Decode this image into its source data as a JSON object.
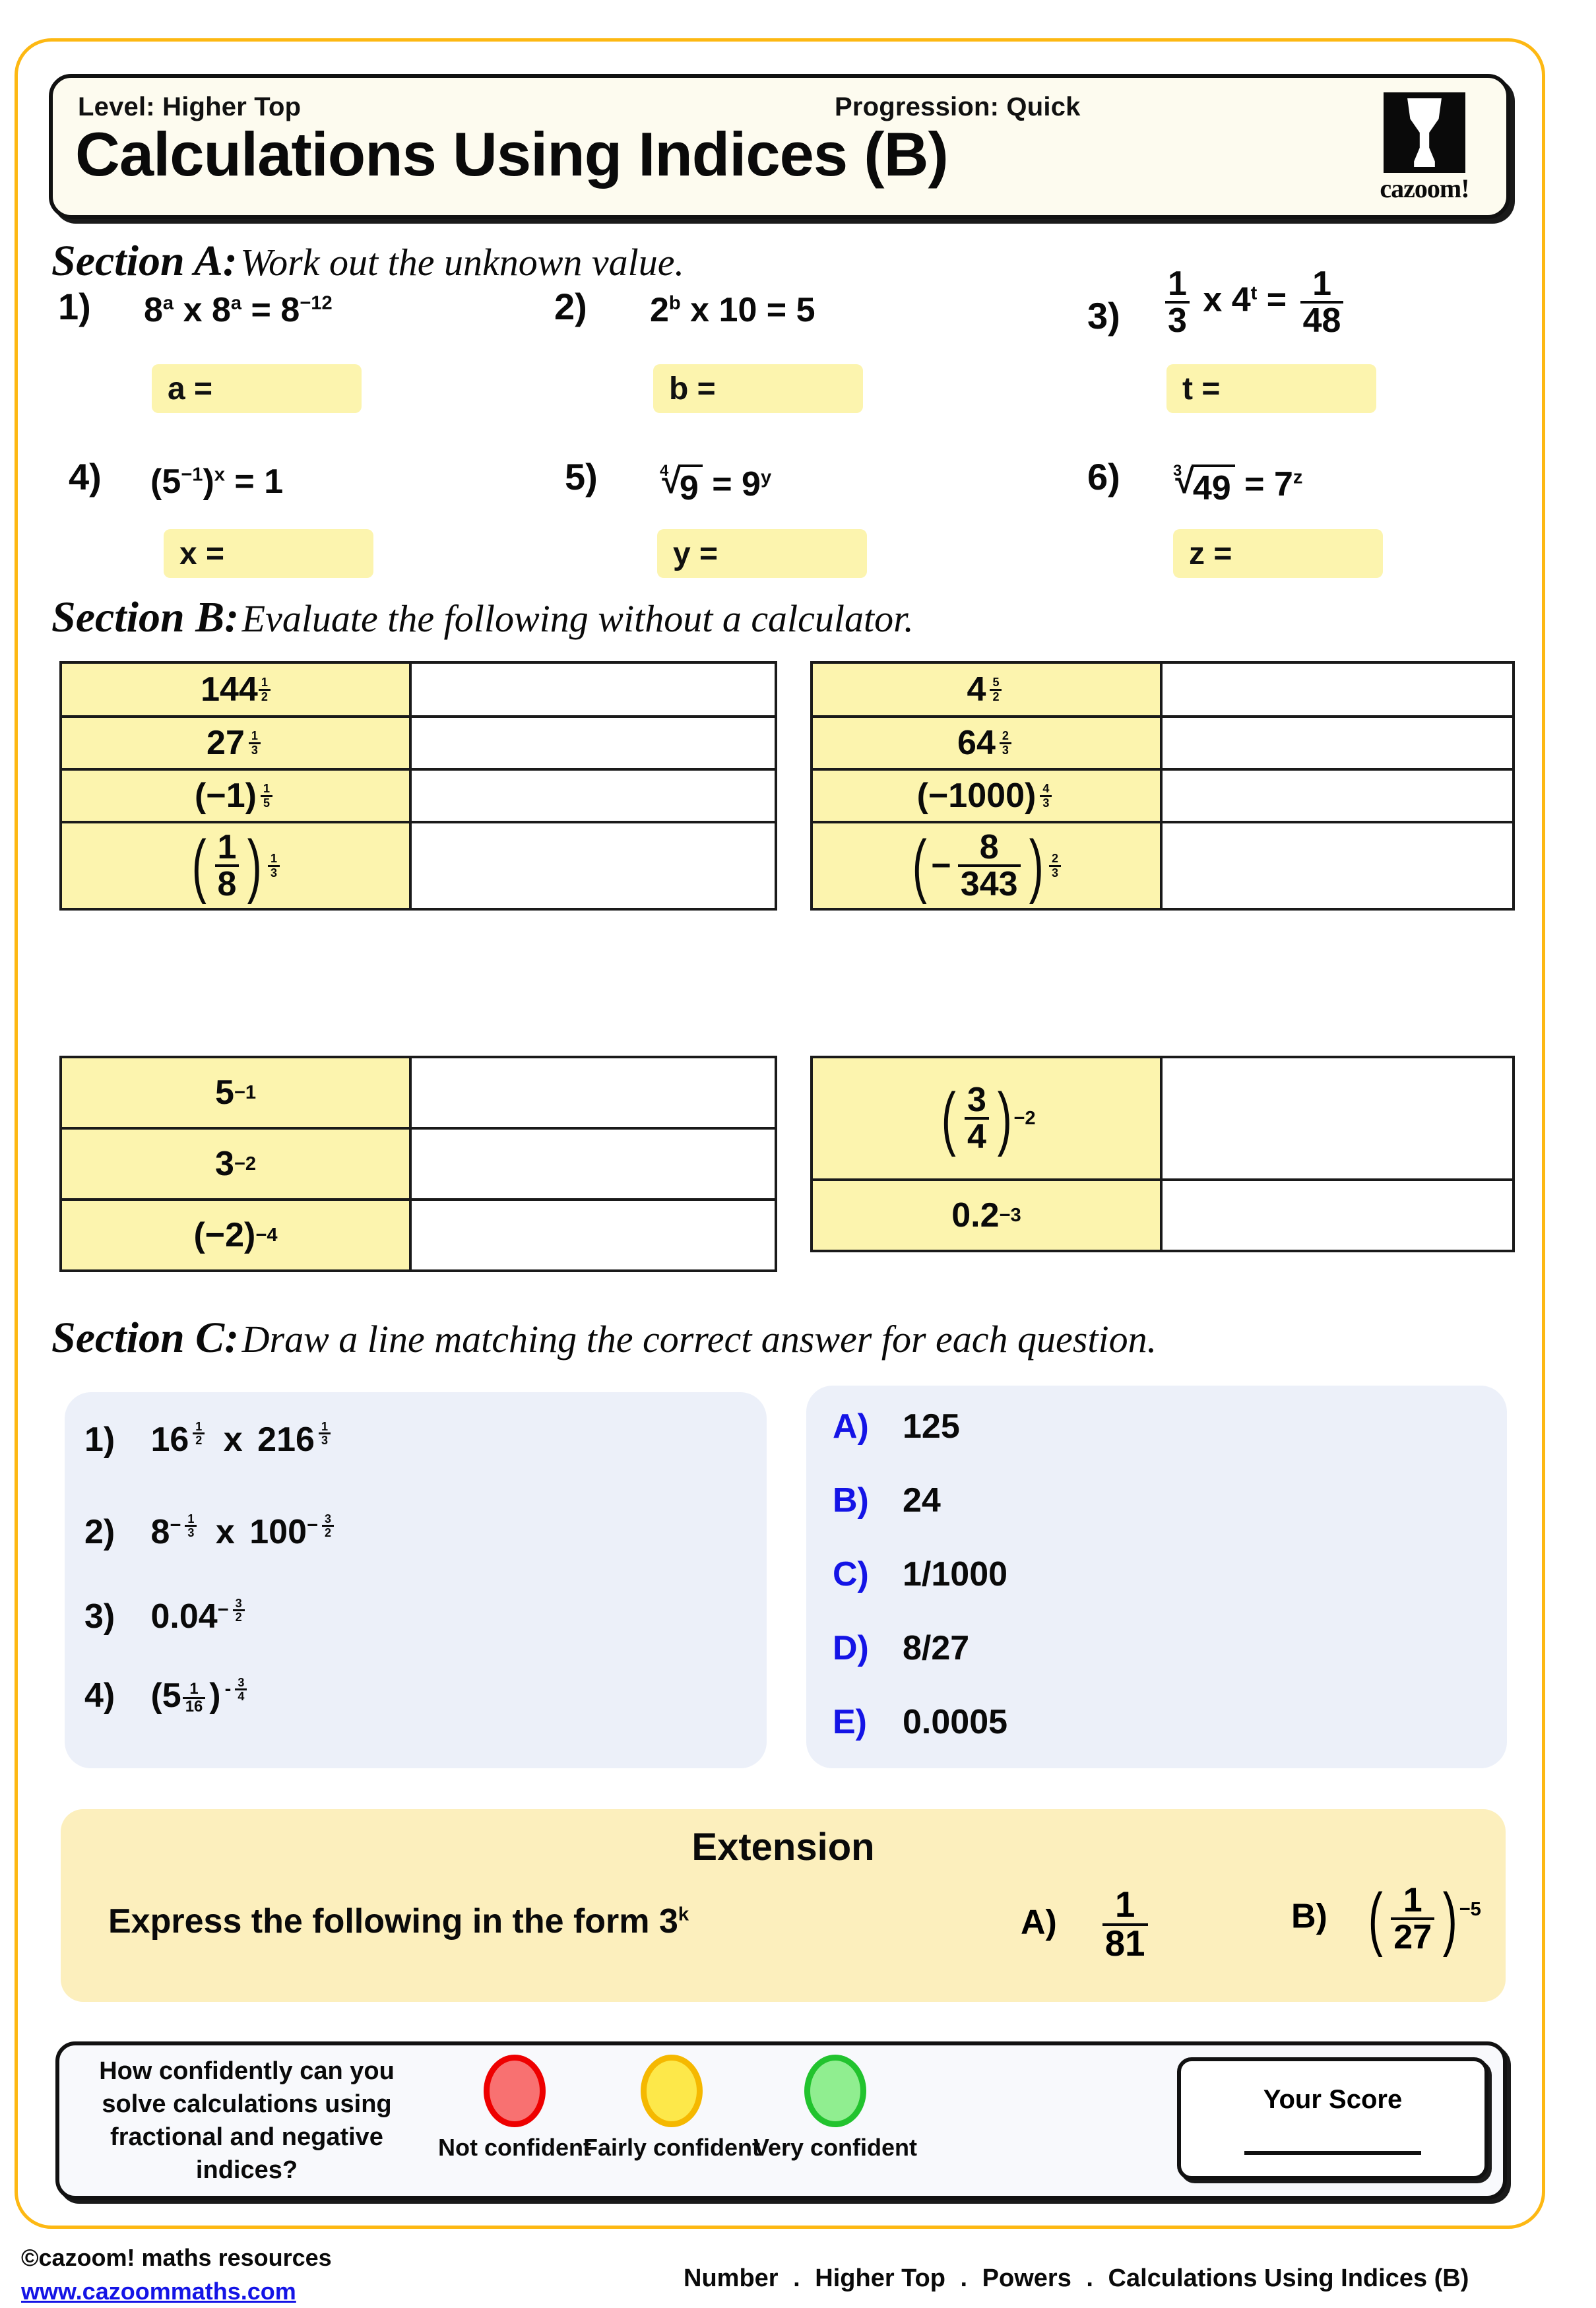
{
  "page": {
    "border_color": "#FDB813",
    "background": "#ffffff"
  },
  "header": {
    "level": "Level: Higher Top",
    "progression": "Progression: Quick",
    "title": "Calculations Using Indices (B)",
    "logo_word": "cazoom!",
    "logo_icon": "cazoom-goblet-logo"
  },
  "sectionA": {
    "label": "Section A:",
    "instruction": "Work out the unknown value.",
    "questions": [
      {
        "num": "1)",
        "expr": "8ᵃ x 8ᵃ = 8⁻¹²",
        "answer_label": "a =",
        "answer_value": ""
      },
      {
        "num": "2)",
        "expr": "2ᵇ x 10 = 5",
        "answer_label": "b =",
        "answer_value": ""
      },
      {
        "num": "3)",
        "expr": "1/3 x 4ᵗ = 1/48",
        "answer_label": "t =",
        "answer_value": ""
      },
      {
        "num": "4)",
        "expr": "(5⁻¹)ˣ = 1",
        "answer_label": "x =",
        "answer_value": ""
      },
      {
        "num": "5)",
        "expr": "⁴√9 = 9ʸ",
        "answer_label": "y =",
        "answer_value": ""
      },
      {
        "num": "6)",
        "expr": "³√49 = 7ᶻ",
        "answer_label": "z =",
        "answer_value": ""
      }
    ]
  },
  "sectionB": {
    "label": "Section B:",
    "instruction": "Evaluate the following without a calculator.",
    "group1_left": [
      {
        "question": "144^(1/2)",
        "answer": ""
      },
      {
        "question": "27^(1/3)",
        "answer": ""
      },
      {
        "question": "(-1)^(1/5)",
        "answer": ""
      },
      {
        "question": "(1/8)^(1/3)",
        "answer": ""
      }
    ],
    "group1_right": [
      {
        "question": "4^(5/2)",
        "answer": ""
      },
      {
        "question": "64^(2/3)",
        "answer": ""
      },
      {
        "question": "(-1000)^(4/3)",
        "answer": ""
      },
      {
        "question": "(-8/343)^(2/3)",
        "answer": ""
      }
    ],
    "group2_left": [
      {
        "question": "5^-1",
        "answer": ""
      },
      {
        "question": "3^-2",
        "answer": ""
      },
      {
        "question": "(-2)^-4",
        "answer": ""
      }
    ],
    "group2_right": [
      {
        "question": "(3/4)^-2",
        "answer": ""
      },
      {
        "question": "0.2^-3",
        "answer": ""
      }
    ]
  },
  "sectionC": {
    "label": "Section C:",
    "instruction": "Draw a line matching the correct answer for each question.",
    "questions": [
      {
        "num": "1)",
        "expr": "16^(1/2) x 216^(1/3)"
      },
      {
        "num": "2)",
        "expr": "8^(-1/3) x 100^(-3/2)"
      },
      {
        "num": "3)",
        "expr": "0.04^(-3/2)"
      },
      {
        "num": "4)",
        "expr": "(5 1/16)^(-3/4)"
      }
    ],
    "answers": [
      {
        "letter": "A)",
        "value": "125"
      },
      {
        "letter": "B)",
        "value": "24"
      },
      {
        "letter": "C)",
        "value": "1/1000"
      },
      {
        "letter": "D)",
        "value": "8/27"
      },
      {
        "letter": "E)",
        "value": "0.0005"
      }
    ],
    "answer_letter_color": "#1414E6"
  },
  "extension": {
    "title": "Extension",
    "prompt": "Express the following in the form 3ᵏ",
    "items": [
      {
        "letter": "A)",
        "expr": "1/81"
      },
      {
        "letter": "B)",
        "expr": "(1/27)^-5"
      }
    ]
  },
  "confidence": {
    "question": "How confidently can you solve calculations using fractional and negative indices?",
    "options": [
      {
        "label": "Not confident",
        "fill": "#F87171",
        "stroke": "#EE0000"
      },
      {
        "label": "Fairly confident",
        "fill": "#FDE84A",
        "stroke": "#F5B800"
      },
      {
        "label": "Very confident",
        "fill": "#90EE90",
        "stroke": "#22C32E"
      }
    ],
    "score_title": "Your Score",
    "score_value": ""
  },
  "footer": {
    "copyright": "©cazoom! maths resources",
    "url": "www.cazoommaths.com",
    "breadcrumb": [
      "Number",
      "Higher Top",
      "Powers",
      "Calculations Using Indices (B)"
    ],
    "breadcrumb_separator": "."
  }
}
